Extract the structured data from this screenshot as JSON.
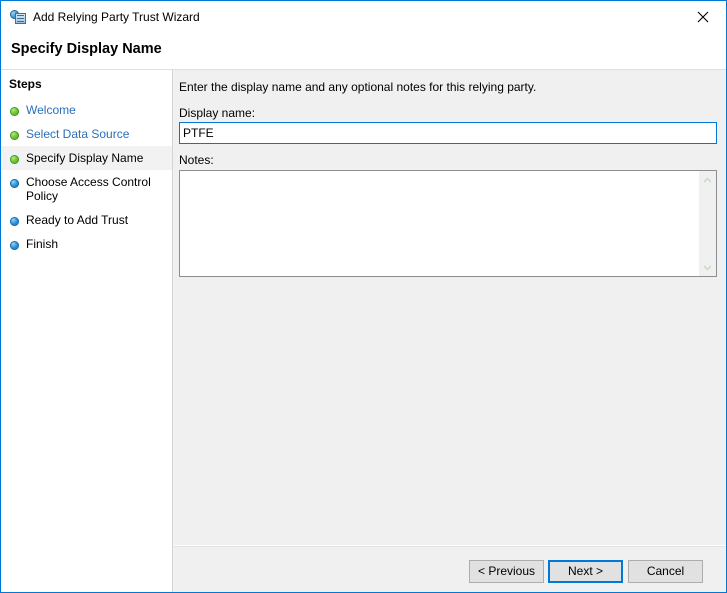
{
  "window": {
    "title": "Add Relying Party Trust Wizard",
    "icon": "relying-party-trust-icon",
    "close_label": "✕",
    "border_color": "#0078d7"
  },
  "header": {
    "title": "Specify Display Name"
  },
  "sidebar": {
    "heading": "Steps",
    "items": [
      {
        "label": "Welcome",
        "state": "done",
        "bullet": "green",
        "link": true,
        "current": false
      },
      {
        "label": "Select Data Source",
        "state": "done",
        "bullet": "green",
        "link": true,
        "current": false
      },
      {
        "label": "Specify Display Name",
        "state": "current",
        "bullet": "green",
        "link": false,
        "current": true
      },
      {
        "label": "Choose Access Control Policy",
        "state": "pending",
        "bullet": "blue",
        "link": false,
        "current": false
      },
      {
        "label": "Ready to Add Trust",
        "state": "pending",
        "bullet": "blue",
        "link": false,
        "current": false
      },
      {
        "label": "Finish",
        "state": "pending",
        "bullet": "blue",
        "link": false,
        "current": false
      }
    ]
  },
  "content": {
    "instruction": "Enter the display name and any optional notes for this relying party.",
    "display_name": {
      "label": "Display name:",
      "value": "PTFE",
      "placeholder": ""
    },
    "notes": {
      "label": "Notes:",
      "value": "",
      "placeholder": ""
    },
    "scrollbar": {
      "up_icon": "chevron-up-icon",
      "down_icon": "chevron-down-icon"
    }
  },
  "footer": {
    "previous_label": "< Previous",
    "next_label": "Next >",
    "cancel_label": "Cancel"
  }
}
